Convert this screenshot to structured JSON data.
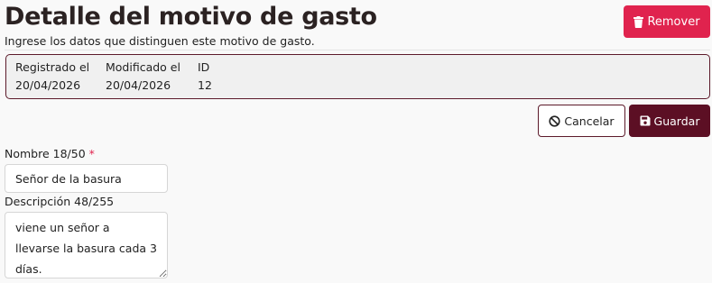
{
  "page": {
    "title": "Detalle del motivo de gasto",
    "subtitle": "Ingrese los datos que distinguen este motivo de gasto."
  },
  "actions": {
    "remove_label": "Remover",
    "remove_icon": "trash-icon",
    "remove_color": "#e0234e",
    "cancel_label": "Cancelar",
    "cancel_icon": "ban-icon",
    "save_label": "Guardar",
    "save_icon": "floppy-disk-icon",
    "save_color": "#5c0f24"
  },
  "record_info": {
    "created_label": "Registrado el",
    "created_value": "20/04/2026",
    "modified_label": "Modificado el",
    "modified_value": "20/04/2026",
    "id_label": "ID",
    "id_value": "12"
  },
  "form": {
    "name": {
      "label": "Nombre 18/50",
      "required_mark": "*",
      "value": "Señor de la basura"
    },
    "description": {
      "label": "Descripción 48/255",
      "value": "viene un señor a llevarse la basura cada 3 días."
    }
  }
}
